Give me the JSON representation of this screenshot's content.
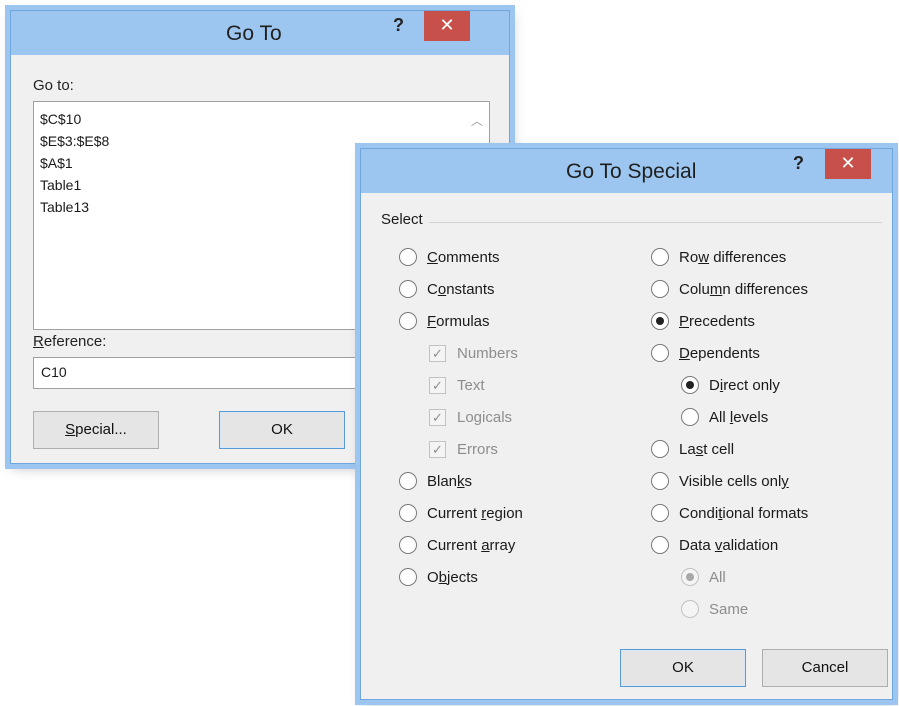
{
  "goto_dialog": {
    "title": "Go To",
    "help": "?",
    "close": "✕",
    "go_to_label": "Go to:",
    "list_items": [
      "$C$10",
      "$E$3:$E$8",
      "$A$1",
      "Table1",
      "Table13"
    ],
    "reference_label_parts": [
      "R",
      "eference:"
    ],
    "reference_value": "C10",
    "special_button_parts": [
      "S",
      "pecial..."
    ],
    "ok_button": "OK"
  },
  "special_dialog": {
    "title": "Go To Special",
    "help": "?",
    "close": "✕",
    "select_label": "Select",
    "options": {
      "comments": [
        "",
        "C",
        "omments"
      ],
      "constants": [
        "C",
        "o",
        "nstants"
      ],
      "formulas": [
        "",
        "F",
        "ormulas"
      ],
      "numbers": "Numbers",
      "text": "Text",
      "logicals": "Logicals",
      "errors": "Errors",
      "blanks": [
        "Blan",
        "k",
        "s"
      ],
      "current_region": [
        "Current ",
        "r",
        "egion"
      ],
      "current_array": [
        "Current ",
        "a",
        "rray"
      ],
      "objects": [
        "O",
        "b",
        "jects"
      ],
      "row_differences": [
        "Ro",
        "w",
        " differences"
      ],
      "column_differences": [
        "Colu",
        "m",
        "n differences"
      ],
      "precedents": [
        "",
        "P",
        "recedents"
      ],
      "dependents": [
        "",
        "D",
        "ependents"
      ],
      "direct_only": [
        "D",
        "i",
        "rect only"
      ],
      "all_levels": [
        "All ",
        "l",
        "evels"
      ],
      "last_cell": [
        "La",
        "s",
        "t cell"
      ],
      "visible_cells_only": [
        "Visible cells onl",
        "y",
        ""
      ],
      "conditional_formats": [
        "Condi",
        "t",
        "ional formats"
      ],
      "data_validation": [
        "Data ",
        "v",
        "alidation"
      ],
      "all": "All",
      "same": "Same"
    },
    "selected": [
      "precedents",
      "direct_only",
      "all"
    ],
    "ok_button": "OK",
    "cancel_button": "Cancel"
  },
  "colors": {
    "titlebar": "#9cc6ef",
    "close_button": "#c7504a",
    "dialog_bg": "#f0f0f0"
  }
}
